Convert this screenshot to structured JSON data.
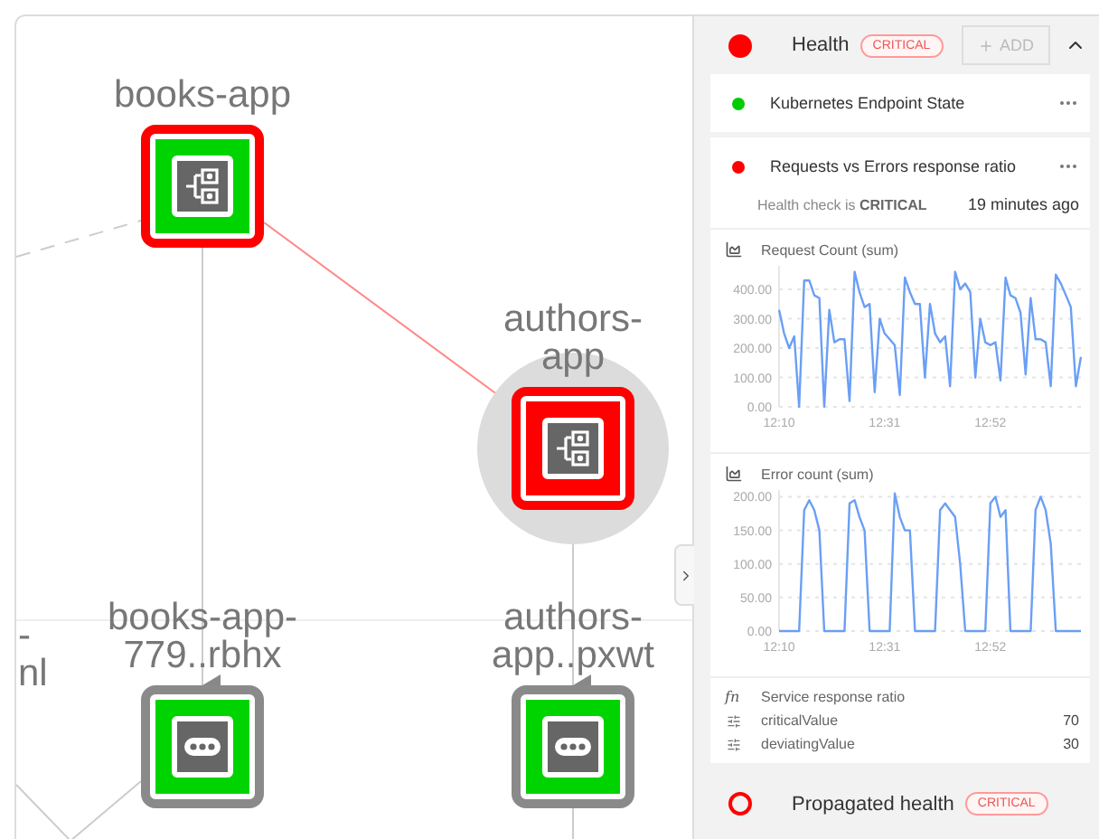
{
  "graph": {
    "nodes": [
      {
        "kind": "offscreen",
        "label_lines": [
          "-",
          "nl"
        ]
      },
      {
        "kind": "service",
        "label_lines": [
          "books-app"
        ],
        "critical": false,
        "alert": true,
        "selected": false
      },
      {
        "kind": "service",
        "label_lines": [
          "authors-",
          "app"
        ],
        "critical": true,
        "alert": true,
        "selected": true
      },
      {
        "kind": "pod",
        "label_lines": [
          "books-app-",
          "779..rbhx"
        ],
        "critical": false,
        "alert": false,
        "selected": false
      },
      {
        "kind": "pod",
        "label_lines": [
          "authors-",
          "app..pxwt"
        ],
        "critical": false,
        "alert": false,
        "selected": false
      }
    ]
  },
  "panel": {
    "health": {
      "title": "Health",
      "critical": true,
      "badge": "CRITICAL",
      "add_button": {
        "label": "ADD",
        "disabled": true
      },
      "expanded": true
    },
    "checks": [
      {
        "name": "Kubernetes Endpoint State",
        "color": "#00cc00",
        "expanded": false
      },
      {
        "name": "Requests vs Errors response ratio",
        "color": "#ff0000",
        "expanded": true,
        "summary": "Health check is **CRITICAL**",
        "time": "19 minutes ago",
        "charts": [
          {
            "title": "Request Count (sum)",
            "chart_data": {
              "type": "line",
              "categories": [
                "12:10",
                null,
                null,
                null,
                null,
                null,
                null,
                null,
                null,
                null,
                null,
                null,
                null,
                null,
                null,
                null,
                null,
                null,
                null,
                null,
                null,
                "12:31",
                null,
                null,
                null,
                null,
                null,
                null,
                null,
                null,
                null,
                null,
                null,
                null,
                null,
                null,
                null,
                null,
                null,
                null,
                null,
                null,
                "12:52",
                null,
                null,
                null,
                null,
                null,
                null,
                null,
                null,
                null,
                null,
                null,
                null,
                null,
                null,
                null,
                null,
                null,
                null
              ],
              "grid": true,
              "ylim": [
                0,
                480
              ],
              "yticks": [
                {
                  "value": 0,
                  "label": "0.00"
                },
                {
                  "value": 100,
                  "label": "100.00"
                },
                {
                  "value": 200,
                  "label": "200.00"
                },
                {
                  "value": 300,
                  "label": "300.00"
                },
                {
                  "value": 400,
                  "label": "400.00"
                }
              ],
              "series": [
                {
                  "color": "#6a9ff5",
                  "values": [
                    330,
                    250,
                    200,
                    240,
                    0,
                    430,
                    430,
                    380,
                    370,
                    0,
                    330,
                    220,
                    230,
                    230,
                    20,
                    460,
                    390,
                    340,
                    350,
                    50,
                    300,
                    250,
                    230,
                    210,
                    40,
                    440,
                    390,
                    350,
                    350,
                    100,
                    350,
                    250,
                    220,
                    240,
                    70,
                    460,
                    400,
                    420,
                    390,
                    100,
                    300,
                    220,
                    210,
                    220,
                    90,
                    440,
                    380,
                    370,
                    320,
                    110,
                    370,
                    230,
                    230,
                    220,
                    70,
                    450,
                    420,
                    380,
                    340,
                    70,
                    170
                  ]
                }
              ]
            }
          },
          {
            "title": "Error count (sum)",
            "chart_data": {
              "type": "line",
              "categories": [
                "12:10",
                null,
                null,
                null,
                null,
                null,
                null,
                null,
                null,
                null,
                null,
                null,
                null,
                null,
                null,
                null,
                null,
                null,
                null,
                null,
                null,
                "12:31",
                null,
                null,
                null,
                null,
                null,
                null,
                null,
                null,
                null,
                null,
                null,
                null,
                null,
                null,
                null,
                null,
                null,
                null,
                null,
                null,
                "12:52",
                null,
                null,
                null,
                null,
                null,
                null,
                null,
                null,
                null,
                null,
                null,
                null,
                null,
                null,
                null,
                null,
                null,
                null
              ],
              "grid": true,
              "ylim": [
                0,
                210
              ],
              "yticks": [
                {
                  "value": 0,
                  "label": "0.00"
                },
                {
                  "value": 50,
                  "label": "50.00"
                },
                {
                  "value": 100,
                  "label": "100.00"
                },
                {
                  "value": 150,
                  "label": "150.00"
                },
                {
                  "value": 200,
                  "label": "200.00"
                }
              ],
              "series": [
                {
                  "color": "#6a9ff5",
                  "values": [
                    0,
                    0,
                    0,
                    0,
                    0,
                    180,
                    195,
                    180,
                    150,
                    0,
                    0,
                    0,
                    0,
                    0,
                    190,
                    195,
                    170,
                    150,
                    0,
                    0,
                    0,
                    0,
                    0,
                    205,
                    170,
                    150,
                    150,
                    0,
                    0,
                    0,
                    0,
                    0,
                    180,
                    190,
                    180,
                    170,
                    100,
                    0,
                    0,
                    0,
                    0,
                    0,
                    190,
                    200,
                    170,
                    180,
                    0,
                    0,
                    0,
                    0,
                    0,
                    180,
                    200,
                    180,
                    130,
                    0,
                    0,
                    0,
                    0,
                    0,
                    0
                  ]
                }
              ]
            }
          }
        ],
        "function_icon": "fn",
        "function": "Service response ratio",
        "params": [
          {
            "name": "criticalValue",
            "value": "70"
          },
          {
            "name": "deviatingValue",
            "value": "30"
          }
        ]
      }
    ],
    "propagated": {
      "title": "Propagated health",
      "critical": true,
      "badge": "CRITICAL"
    }
  }
}
